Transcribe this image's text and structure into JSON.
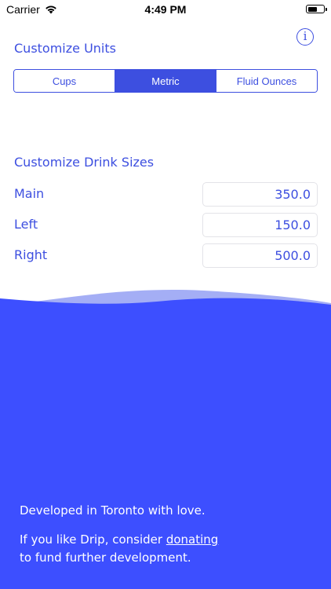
{
  "status_bar": {
    "carrier": "Carrier",
    "time": "4:49 PM"
  },
  "units": {
    "title": "Customize Units",
    "info_icon": "info-icon",
    "segments": [
      "Cups",
      "Metric",
      "Fluid Ounces"
    ],
    "selected": "Metric"
  },
  "drink_sizes": {
    "title": "Customize Drink Sizes",
    "rows": [
      {
        "label": "Main",
        "value": "350.0"
      },
      {
        "label": "Left",
        "value": "150.0"
      },
      {
        "label": "Right",
        "value": "500.0"
      }
    ]
  },
  "footer": {
    "line1": "Developed in Toronto with love.",
    "line2_prefix": "If you like Drip, consider ",
    "donate_link": "donating",
    "line3": "to fund further development."
  },
  "colors": {
    "accent": "#3d4fe0",
    "wave_light": "#a4aef5",
    "wave_dark": "#3d4fff"
  }
}
